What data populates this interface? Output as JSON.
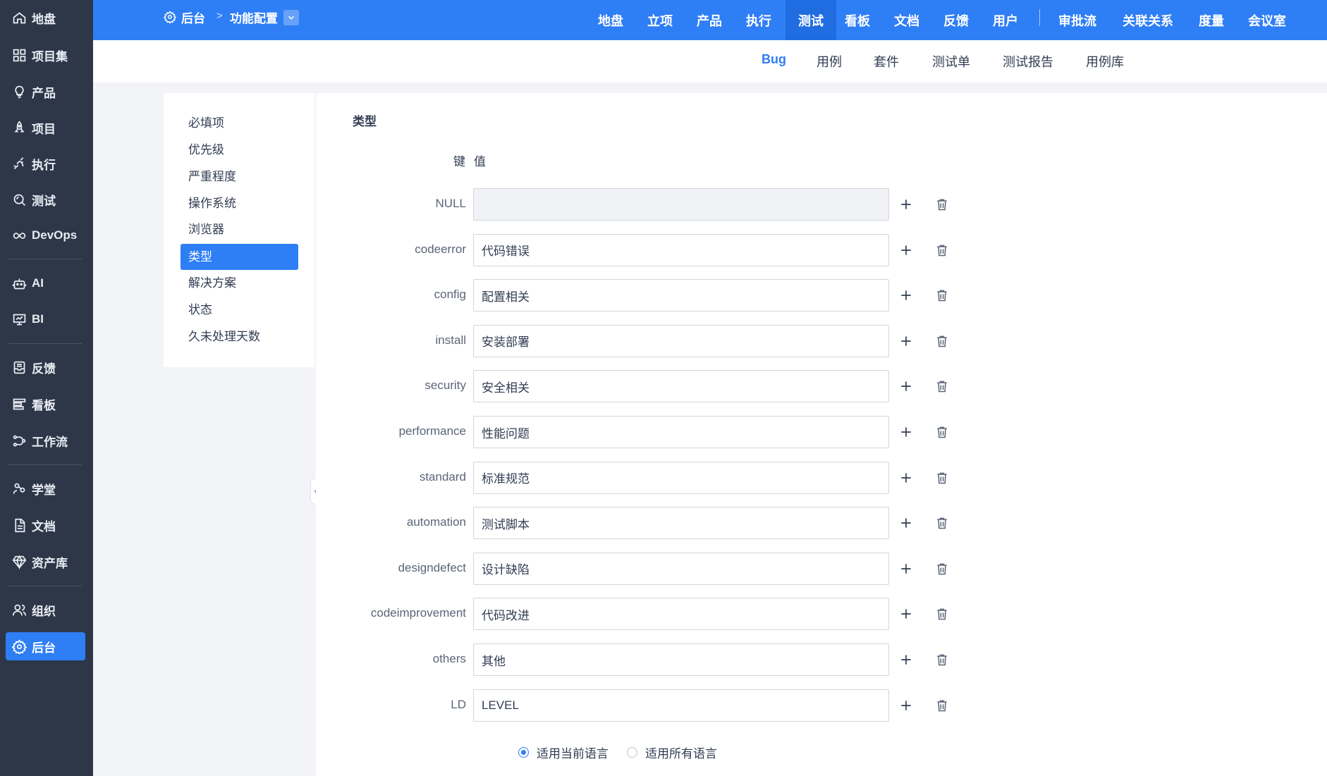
{
  "sidebar": {
    "items": [
      {
        "label": "地盘",
        "icon": "home-icon"
      },
      {
        "label": "项目集",
        "icon": "grid-icon"
      },
      {
        "label": "产品",
        "icon": "lightbulb-icon"
      },
      {
        "label": "项目",
        "icon": "rocket-icon"
      },
      {
        "label": "执行",
        "icon": "run-icon"
      },
      {
        "label": "测试",
        "icon": "search-bug-icon"
      },
      {
        "label": "DevOps",
        "icon": "infinity-icon"
      },
      {
        "label": "AI",
        "icon": "robot-icon"
      },
      {
        "label": "BI",
        "icon": "presentation-icon"
      },
      {
        "label": "反馈",
        "icon": "inbox-icon"
      },
      {
        "label": "看板",
        "icon": "kanban-icon"
      },
      {
        "label": "工作流",
        "icon": "workflow-icon"
      },
      {
        "label": "学堂",
        "icon": "school-icon"
      },
      {
        "label": "文档",
        "icon": "document-icon"
      },
      {
        "label": "资产库",
        "icon": "diamond-icon"
      },
      {
        "label": "组织",
        "icon": "people-icon"
      },
      {
        "label": "后台",
        "icon": "gear-icon"
      }
    ],
    "active": "后台"
  },
  "header": {
    "breadcrumb_root": "后台",
    "breadcrumb_current": "功能配置",
    "nav": [
      "地盘",
      "立项",
      "产品",
      "执行",
      "测试",
      "看板",
      "文档",
      "反馈",
      "用户",
      "审批流",
      "关联关系",
      "度量",
      "会议室"
    ],
    "active_nav": "测试"
  },
  "subnav": {
    "items": [
      "Bug",
      "用例",
      "套件",
      "测试单",
      "测试报告",
      "用例库"
    ],
    "active": "Bug"
  },
  "left_menu": {
    "items": [
      "必填项",
      "优先级",
      "严重程度",
      "操作系统",
      "浏览器",
      "类型",
      "解决方案",
      "状态",
      "久未处理天数"
    ],
    "active": "类型"
  },
  "form": {
    "title": "类型",
    "col_key": "键",
    "col_value": "值",
    "rows": [
      {
        "key": "NULL",
        "value": ""
      },
      {
        "key": "codeerror",
        "value": "代码错误"
      },
      {
        "key": "config",
        "value": "配置相关"
      },
      {
        "key": "install",
        "value": "安装部署"
      },
      {
        "key": "security",
        "value": "安全相关"
      },
      {
        "key": "performance",
        "value": "性能问题"
      },
      {
        "key": "standard",
        "value": "标准规范"
      },
      {
        "key": "automation",
        "value": "测试脚本"
      },
      {
        "key": "designdefect",
        "value": "设计缺陷"
      },
      {
        "key": "codeimprovement",
        "value": "代码改进"
      },
      {
        "key": "others",
        "value": "其他"
      },
      {
        "key": "LD",
        "value": "LEVEL"
      }
    ],
    "lang_current": "适用当前语言",
    "lang_all": "适用所有语言",
    "lang_selected": "current"
  },
  "colors": {
    "primary": "#2e7ef5",
    "sidebar_bg": "#2d3748"
  }
}
